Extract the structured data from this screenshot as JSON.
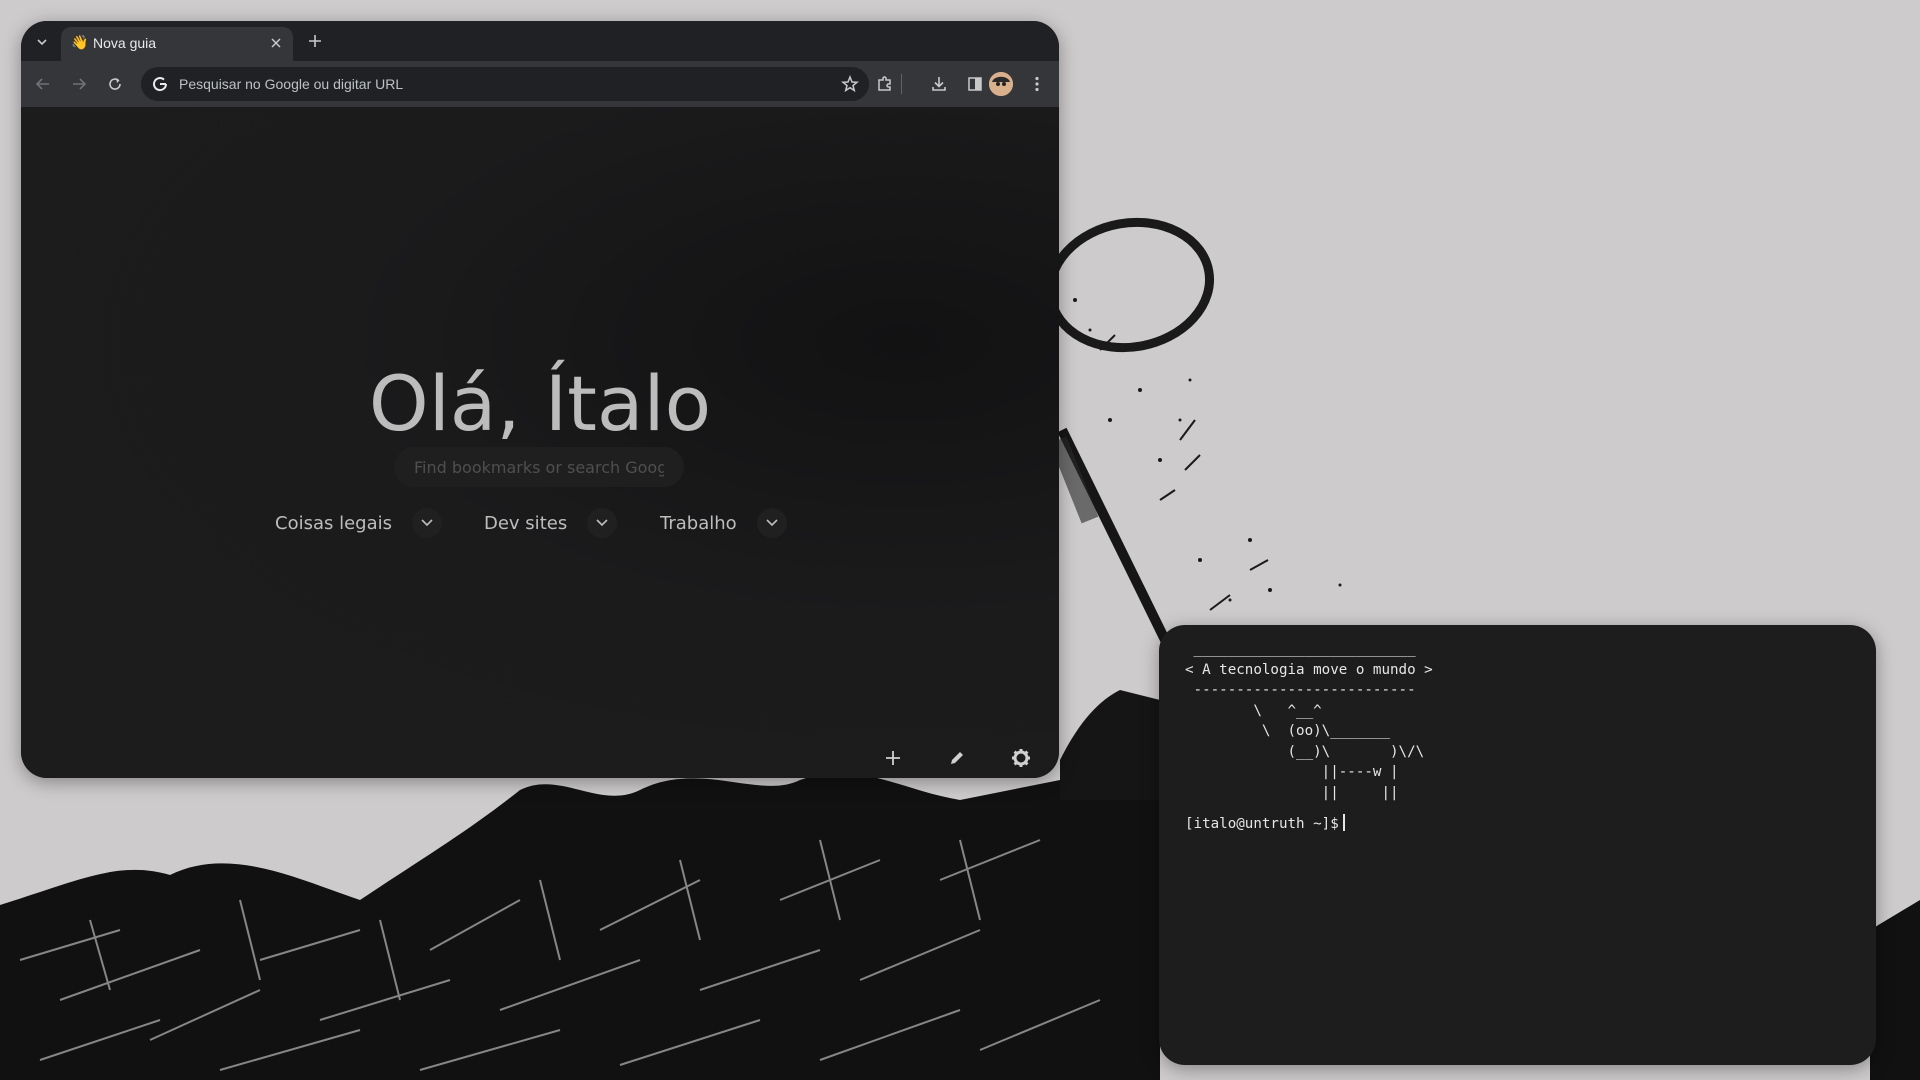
{
  "browser": {
    "tab": {
      "favicon": "👋",
      "title": "Nova guia"
    },
    "omnibox": {
      "placeholder": "Pesquisar no Google ou digitar URL"
    },
    "ntp": {
      "greeting": "Olá, Ítalo",
      "bookmark_search_placeholder": "Find bookmarks or search Googl",
      "folders": [
        {
          "label": "Coisas legais"
        },
        {
          "label": "Dev sites"
        },
        {
          "label": "Trabalho"
        }
      ]
    }
  },
  "terminal": {
    "cowsay": " __________________________\n< A tecnologia move o mundo >\n --------------------------\n        \\   ^__^\n         \\  (oo)\\_______\n            (__)\\       )\\/\\\n                ||----w |\n                ||     ||",
    "prompt": "[italo@untruth ~]$"
  },
  "colors": {
    "desktop_bg": "#cecbcc",
    "browser_bg": "#1a1a1b",
    "toolbar_bg": "#35363a",
    "terminal_bg": "#1d1d1d"
  },
  "icons": [
    "tab-search-icon",
    "wave-icon",
    "close-icon",
    "plus-icon",
    "back-icon",
    "forward-icon",
    "reload-icon",
    "google-g-icon",
    "star-icon",
    "puzzle-icon",
    "download-icon",
    "side-panel-icon",
    "avatar",
    "more-vert-icon",
    "chevron-down-icon",
    "pencil-icon",
    "gear-icon"
  ]
}
